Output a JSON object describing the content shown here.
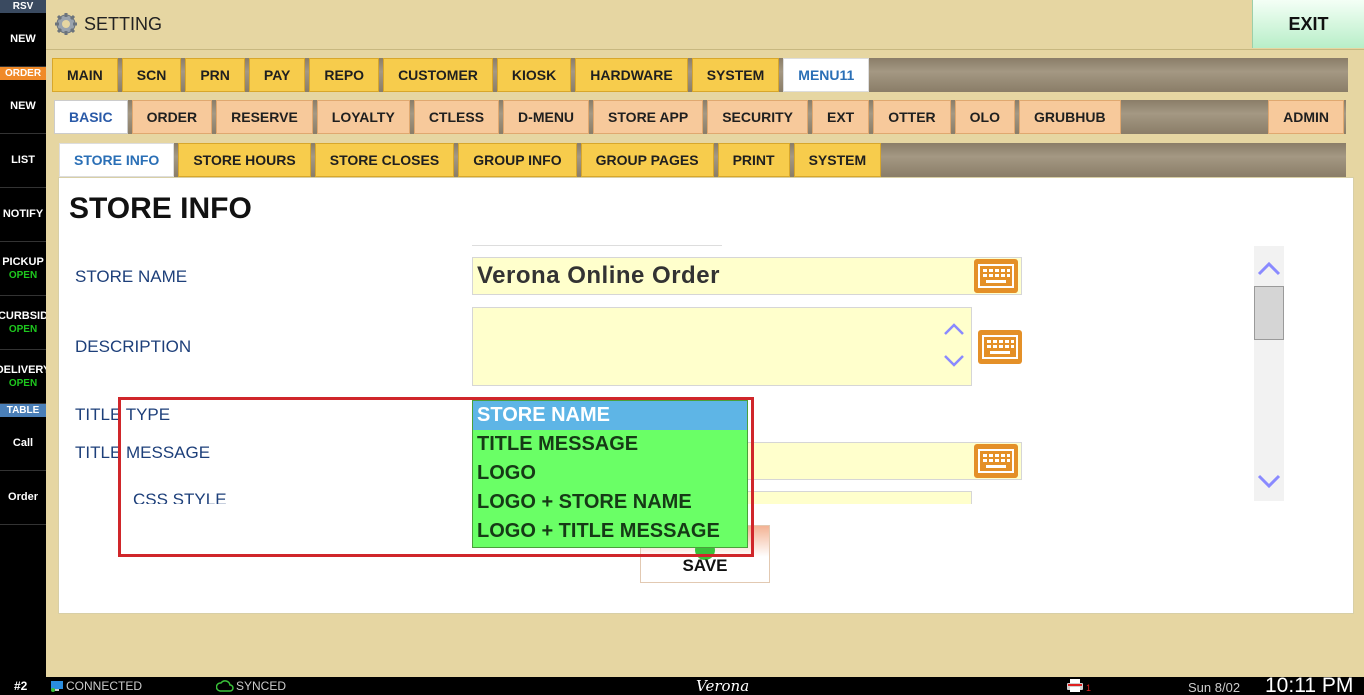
{
  "sidebar": {
    "rsv_header": "RSV",
    "new_reservation": "NEW",
    "order_header": "ORDER",
    "new_order": "NEW",
    "list": "LIST",
    "notify": "NOTIFY",
    "pickup": "PICKUP",
    "pickup_status": "OPEN",
    "curbside": "CURBSID",
    "curbside_status": "OPEN",
    "delivery": "DELIVERY",
    "delivery_status": "OPEN",
    "table_header": "TABLE",
    "call": "Call",
    "order": "Order"
  },
  "topbar": {
    "title": "SETTING",
    "exit_label": "EXIT"
  },
  "tabs_main": [
    "MAIN",
    "SCN",
    "PRN",
    "PAY",
    "REPO",
    "CUSTOMER",
    "KIOSK",
    "HARDWARE",
    "SYSTEM",
    "MENU11"
  ],
  "tabs_main_active": "MENU11",
  "tabs_sub": [
    "BASIC",
    "ORDER",
    "RESERVE",
    "LOYALTY",
    "CTLESS",
    "D-MENU",
    "STORE APP",
    "SECURITY",
    "EXT",
    "OTTER",
    "OLO",
    "GRUBHUB"
  ],
  "tabs_sub_active": "BASIC",
  "tabs_sub_admin": "ADMIN",
  "tabs_section": [
    "STORE INFO",
    "STORE HOURS",
    "STORE CLOSES",
    "GROUP INFO",
    "GROUP PAGES",
    "PRINT",
    "SYSTEM"
  ],
  "tabs_section_active": "STORE INFO",
  "content": {
    "page_title": "STORE INFO",
    "labels": {
      "store_name": "STORE NAME",
      "description": "DESCRIPTION",
      "title_type": "TITLE TYPE",
      "title_message": "TITLE MESSAGE",
      "css_style": "CSS STYLE"
    },
    "store_name_value": "Verona Online Order",
    "description_value": ""
  },
  "dropdown": {
    "options": [
      "STORE NAME",
      "TITLE MESSAGE",
      "LOGO",
      "LOGO + STORE NAME",
      "LOGO + TITLE MESSAGE"
    ],
    "selected": "STORE NAME"
  },
  "save_label": "SAVE",
  "status": {
    "station": "#2",
    "connection": "CONNECTED",
    "sync": "SYNCED",
    "brand": "Verona",
    "printer_count": "1",
    "date": "Sun 8/02",
    "time": "10:11 PM"
  },
  "colors": {
    "accent_tab": "#f7cc4c",
    "sub_tab": "#f7c99b",
    "input_bg": "#ffffcc",
    "dropdown_bg": "#6aff66",
    "dropdown_selected": "#5eb5e6",
    "highlight_border": "#d0262a",
    "keyboard_icon": "#e49028"
  }
}
